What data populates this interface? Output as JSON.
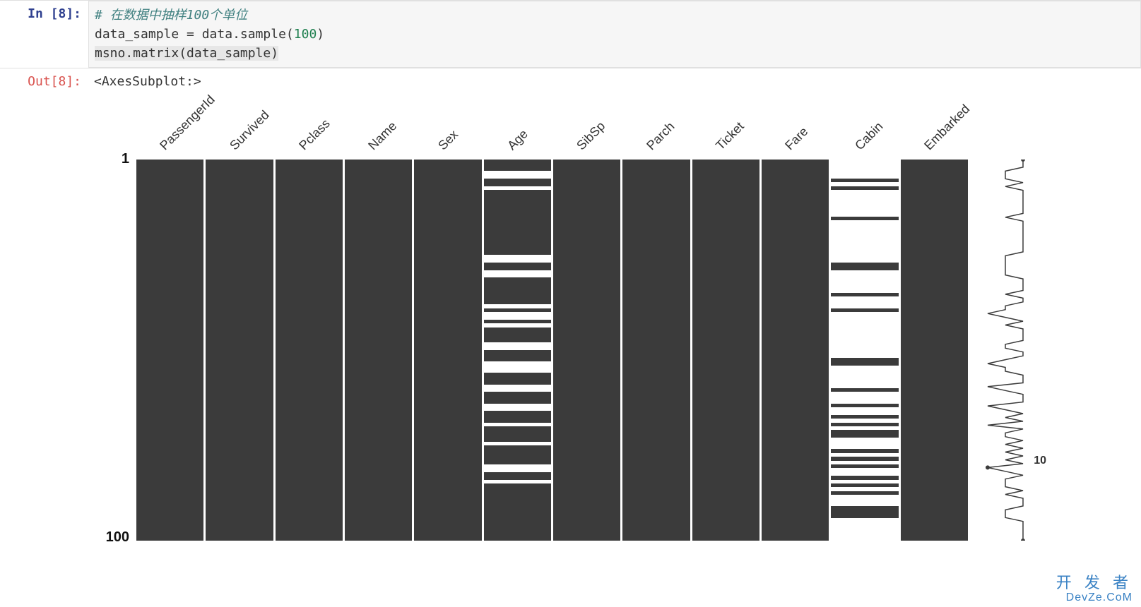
{
  "cell": {
    "in_prompt": "In  [8]:",
    "out_prompt": "Out[8]:",
    "code_comment": "# 在数据中抽样100个单位",
    "code_line2_a": "data_sample = data.sample(",
    "code_line2_num": "100",
    "code_line2_b": ")",
    "code_line3": "msno.matrix(data_sample)",
    "out_text": "<AxesSubplot:>"
  },
  "watermark": {
    "line1": "开 发 者",
    "line2": "DevZe.CoM"
  },
  "chart_data": {
    "type": "missingno-matrix",
    "title": "",
    "n_rows": 100,
    "y_ticks": [
      "1",
      "100"
    ],
    "sparkline_label": "10",
    "columns": [
      {
        "name": "PassengerId",
        "missing_rows": []
      },
      {
        "name": "Survived",
        "missing_rows": []
      },
      {
        "name": "Pclass",
        "missing_rows": []
      },
      {
        "name": "Name",
        "missing_rows": []
      },
      {
        "name": "Sex",
        "missing_rows": []
      },
      {
        "name": "Age",
        "missing_rows": [
          3,
          4,
          7,
          25,
          26,
          29,
          30,
          38,
          40,
          41,
          43,
          48,
          49,
          53,
          54,
          55,
          59,
          60,
          64,
          65,
          69,
          74,
          80,
          81,
          84
        ]
      },
      {
        "name": "SibSp",
        "missing_rows": []
      },
      {
        "name": "Parch",
        "missing_rows": []
      },
      {
        "name": "Ticket",
        "missing_rows": []
      },
      {
        "name": "Fare",
        "missing_rows": []
      },
      {
        "name": "Cabin",
        "present_rows": [
          5,
          7,
          15,
          27,
          28,
          35,
          39,
          52,
          53,
          60,
          64,
          67,
          69,
          71,
          72,
          76,
          78,
          80,
          83,
          85,
          87,
          91,
          92,
          93
        ]
      },
      {
        "name": "Embarked",
        "missing_rows": []
      }
    ],
    "sparkline_completeness": [
      12,
      12,
      12,
      11,
      11,
      11,
      12,
      11,
      12,
      12,
      12,
      12,
      12,
      12,
      12,
      11,
      12,
      12,
      12,
      12,
      12,
      12,
      12,
      12,
      12,
      11,
      11,
      11,
      11,
      11,
      11,
      12,
      12,
      12,
      12,
      11,
      12,
      12,
      11,
      11,
      10,
      11,
      12,
      11,
      12,
      12,
      12,
      12,
      11,
      11,
      12,
      12,
      11,
      10,
      11,
      11,
      12,
      12,
      12,
      10,
      11,
      12,
      12,
      12,
      10,
      11,
      12,
      11,
      12,
      10,
      12,
      11,
      11,
      12,
      11,
      12,
      11,
      12,
      11,
      12,
      10,
      11,
      12,
      11,
      11,
      11,
      12,
      11,
      12,
      12,
      12,
      11,
      11,
      11,
      12,
      12,
      12,
      12,
      12,
      12
    ]
  }
}
